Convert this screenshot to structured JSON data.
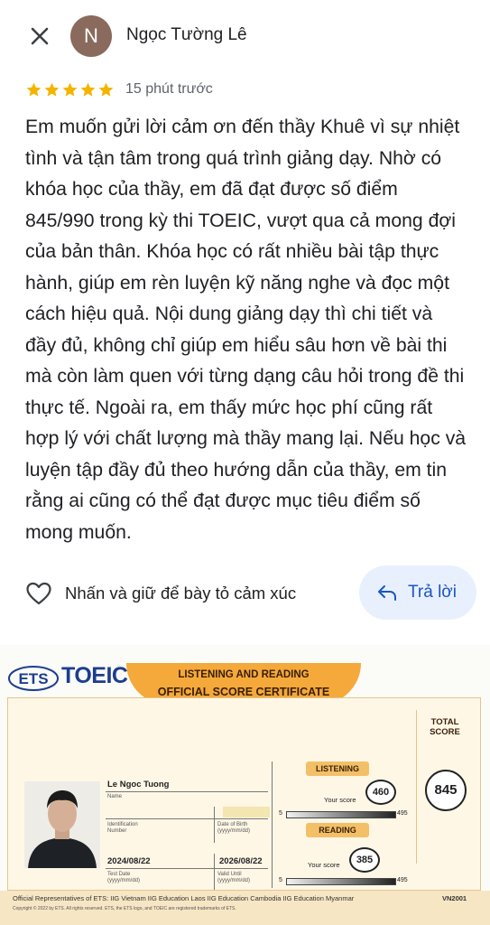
{
  "header": {
    "avatar_letter": "N",
    "reviewer_name": "Ngọc Tường Lê"
  },
  "rating": {
    "stars": 5,
    "time": "15 phút trước",
    "star_color": "#f4b400"
  },
  "review": {
    "text": "Em muốn gửi lời cảm ơn đến thầy Khuê vì sự nhiệt tình và tận tâm trong quá trình giảng dạy. Nhờ có khóa học của thầy, em đã đạt được số điểm 845/990 trong kỳ thi TOEIC, vượt qua cả mong đợi của bản thân. Khóa học có rất nhiều bài tập thực hành, giúp em rèn luyện kỹ năng nghe và đọc một cách hiệu quả. Nội dung giảng dạy thì chi tiết và đầy đủ, không chỉ giúp em hiểu sâu hơn về bài thi mà còn làm quen với từng dạng câu hỏi trong đề thi thực tế. Ngoài ra, em thấy mức học phí cũng rất hợp lý với chất lượng mà thầy mang lại. Nếu học và luyện tập đầy đủ theo hướng dẫn của thầy, em tin rằng ai cũng có thể đạt được mục tiêu điểm số mong muốn."
  },
  "actions": {
    "react_label": "Nhấn và giữ để bày tỏ cảm xúc",
    "reply_label": "Trả lời",
    "reply_color": "#1a56c4"
  },
  "certificate": {
    "ets": "ETS",
    "toeic": "TOEIC",
    "banner_line1": "LISTENING AND READING",
    "banner_line2": "OFFICIAL SCORE CERTIFICATE",
    "name_value": "Le Ngoc Tuong",
    "name_label": "Name",
    "identification_label": "Identification Number",
    "dob_label": "Date of Birth (yyyy/mm/dd)",
    "test_date": "2024/08/22",
    "test_date_label": "Test Date (yyyy/mm/dd)",
    "valid_until": "2026/08/22",
    "valid_until_label": "Valid Until (yyyy/mm/dd)",
    "listening_label": "LISTENING",
    "reading_label": "READING",
    "your_score_label": "Your score",
    "listening_score": "460",
    "reading_score": "385",
    "scale_min": "5",
    "scale_max": "495",
    "total_label_1": "TOTAL",
    "total_label_2": "SCORE",
    "total_score": "845",
    "footer_reps": "Official Representatives of ETS: IIG Vietnam   IIG Education Laos   IIG Education Cambodia   IIG Education Myanmar",
    "footer_code": "VN2001",
    "footer_copyright": "Copyright © 2022 by ETS. All rights reserved. ETS, the ETS logo, and TOEIC are registered trademarks of ETS."
  }
}
